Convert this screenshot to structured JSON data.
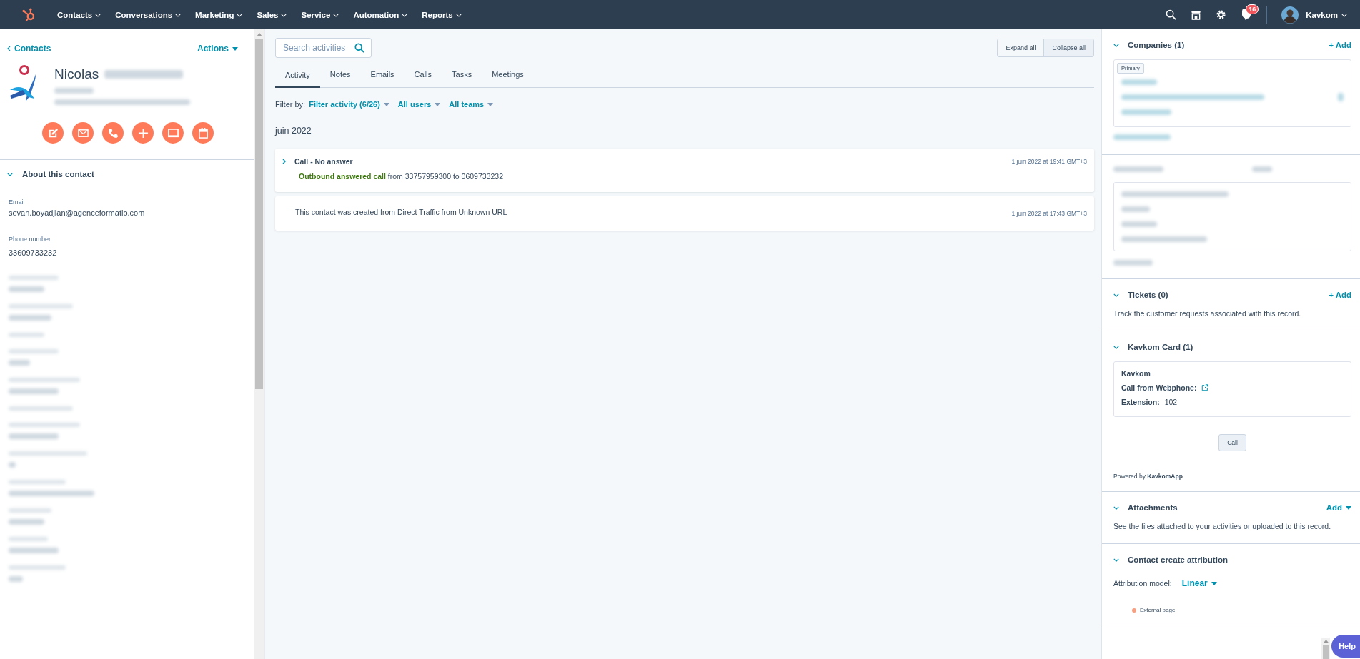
{
  "top_nav": {
    "menu": [
      {
        "label": "Contacts"
      },
      {
        "label": "Conversations"
      },
      {
        "label": "Marketing"
      },
      {
        "label": "Sales"
      },
      {
        "label": "Service"
      },
      {
        "label": "Automation"
      },
      {
        "label": "Reports"
      }
    ],
    "notifications": "16",
    "account": "Kavkom"
  },
  "contact_panel": {
    "back_link": "Contacts",
    "actions": "Actions",
    "first_name": "Nicolas",
    "about_title": "About this contact",
    "properties": [
      {
        "label": "Email",
        "value": "sevan.boyadjian@agenceformatio.com"
      },
      {
        "label": "Phone number",
        "value": "33609733232"
      }
    ]
  },
  "activity": {
    "search": {
      "placeholder": "Search activities"
    },
    "view_buttons": [
      {
        "label": "Expand all",
        "selected": false
      },
      {
        "label": "Collapse all",
        "selected": true
      }
    ],
    "tabs": [
      {
        "label": "Activity",
        "selected": true
      },
      {
        "label": "Notes",
        "selected": false
      },
      {
        "label": "Emails",
        "selected": false
      },
      {
        "label": "Calls",
        "selected": false
      },
      {
        "label": "Tasks",
        "selected": false
      },
      {
        "label": "Meetings",
        "selected": false
      }
    ],
    "filter_label": "Filter by:",
    "filters": [
      {
        "label": "Filter activity (6/26)"
      },
      {
        "label": "All users"
      },
      {
        "label": "All teams"
      }
    ],
    "month": "juin 2022",
    "items": [
      {
        "kind": "call",
        "title": "Call - No answer",
        "outcome": "Outbound answered call",
        "detail": "from 33757959300 to 0609733232",
        "timestamp": "1 juin 2022 at 19:41 GMT+3"
      },
      {
        "kind": "event",
        "text": "This contact was created from Direct Traffic from Unknown URL",
        "timestamp": "1 juin 2022 at 17:43 GMT+3"
      }
    ]
  },
  "sidebar": {
    "sections": [
      {
        "kind": "companies",
        "title": "Companies (1)",
        "action": "+ Add",
        "tag": "Primary"
      },
      {
        "kind": "blurred"
      },
      {
        "kind": "tickets",
        "title": "Tickets (0)",
        "action": "+ Add",
        "description": "Track the customer requests associated with this record."
      },
      {
        "kind": "app_card",
        "title": "Kavkom Card (1)",
        "card_title": "Kavkom",
        "link_label": "Call from Webphone:",
        "field_label": "Extension:",
        "field_value": "102",
        "button": "Call",
        "footer": "Powered by **KavkomApp**"
      },
      {
        "kind": "attachments",
        "title": "Attachments",
        "action": "Add",
        "description": "See the files attached to your activities or uploaded to this record."
      },
      {
        "kind": "attribution",
        "title": "Contact create attribution",
        "model_label": "Attribution model:",
        "model": "Linear",
        "legend": [
          {
            "label": "External page",
            "color": "#f5a083"
          }
        ]
      }
    ]
  },
  "help": "Help"
}
